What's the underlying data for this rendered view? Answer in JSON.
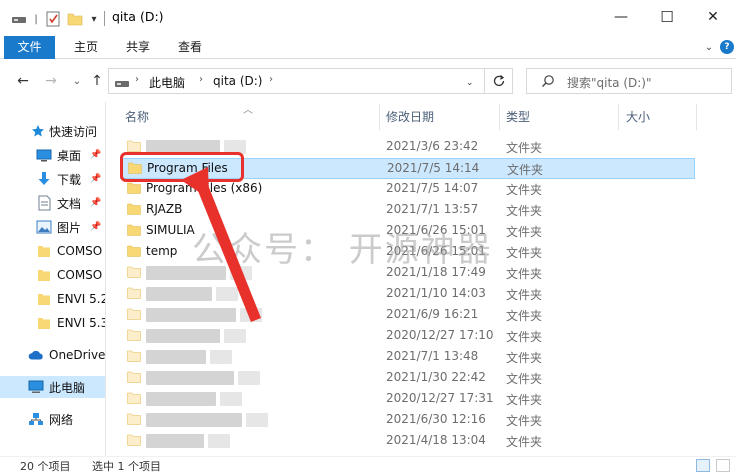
{
  "window": {
    "title": "qita (D:)",
    "minimize_glyph": "—",
    "maximize_glyph": "☐",
    "close_glyph": "✕"
  },
  "ribbon": {
    "tabs": [
      "文件",
      "主页",
      "共享",
      "查看"
    ],
    "expand_glyph": "⌄",
    "help_glyph": "?"
  },
  "nav": {
    "back_glyph": "←",
    "forward_glyph": "→",
    "recent_glyph": "⌄",
    "up_glyph": "↑",
    "breadcrumb": [
      "此电脑",
      "qita (D:)"
    ],
    "search_placeholder": "搜索\"qita (D:)\""
  },
  "sidebar": {
    "items": [
      {
        "label": "快速访问",
        "icon": "star-icon"
      },
      {
        "label": "桌面",
        "icon": "desktop-icon",
        "pinned": true
      },
      {
        "label": "下载",
        "icon": "download-icon",
        "pinned": true
      },
      {
        "label": "文档",
        "icon": "document-icon",
        "pinned": true
      },
      {
        "label": "图片",
        "icon": "picture-icon",
        "pinned": true
      },
      {
        "label": "COMSO",
        "icon": "folder-icon"
      },
      {
        "label": "COMSO",
        "icon": "folder-icon"
      },
      {
        "label": "ENVI 5.2",
        "icon": "folder-icon"
      },
      {
        "label": "ENVI 5.3",
        "icon": "folder-icon"
      },
      {
        "label": "OneDrive",
        "icon": "cloud-icon"
      },
      {
        "label": "此电脑",
        "icon": "computer-icon",
        "selected": true
      },
      {
        "label": "网络",
        "icon": "network-icon"
      }
    ]
  },
  "columns": {
    "name": "名称",
    "date": "修改日期",
    "type": "类型",
    "size": "大小"
  },
  "files": [
    {
      "name": "",
      "date": "2021/3/6 23:42",
      "type": "文件夹"
    },
    {
      "name": "Program Files",
      "date": "2021/7/5 14:14",
      "type": "文件夹",
      "selected": true
    },
    {
      "name": "Program Files (x86)",
      "date": "2021/7/5 14:07",
      "type": "文件夹"
    },
    {
      "name": "RJAZB",
      "date": "2021/7/1 13:57",
      "type": "文件夹"
    },
    {
      "name": "SIMULIA",
      "date": "2021/6/26 15:01",
      "type": "文件夹"
    },
    {
      "name": "temp",
      "date": "2021/6/26 15:01",
      "type": "文件夹"
    },
    {
      "name": "",
      "date": "2021/1/18 17:49",
      "type": "文件夹"
    },
    {
      "name": "",
      "date": "2021/1/10 14:03",
      "type": "文件夹"
    },
    {
      "name": "",
      "date": "2021/6/9 16:21",
      "type": "文件夹"
    },
    {
      "name": "",
      "date": "2020/12/27 17:10",
      "type": "文件夹"
    },
    {
      "name": "",
      "date": "2021/7/1 13:48",
      "type": "文件夹"
    },
    {
      "name": "",
      "date": "2021/1/30 22:42",
      "type": "文件夹"
    },
    {
      "name": "",
      "date": "2020/12/27 17:31",
      "type": "文件夹"
    },
    {
      "name": "",
      "date": "2021/6/30 12:16",
      "type": "文件夹"
    },
    {
      "name": "",
      "date": "2021/4/18 13:04",
      "type": "文件夹"
    }
  ],
  "status": {
    "item_count": "20 个项目",
    "selected": "选中 1 个项目"
  },
  "annotation": {
    "watermark": "公众号：  开源神器"
  },
  "colors": {
    "accent": "#1979ca",
    "selection": "#cce8ff",
    "folder": "#f8d775",
    "annotation_red": "#e8312a"
  }
}
